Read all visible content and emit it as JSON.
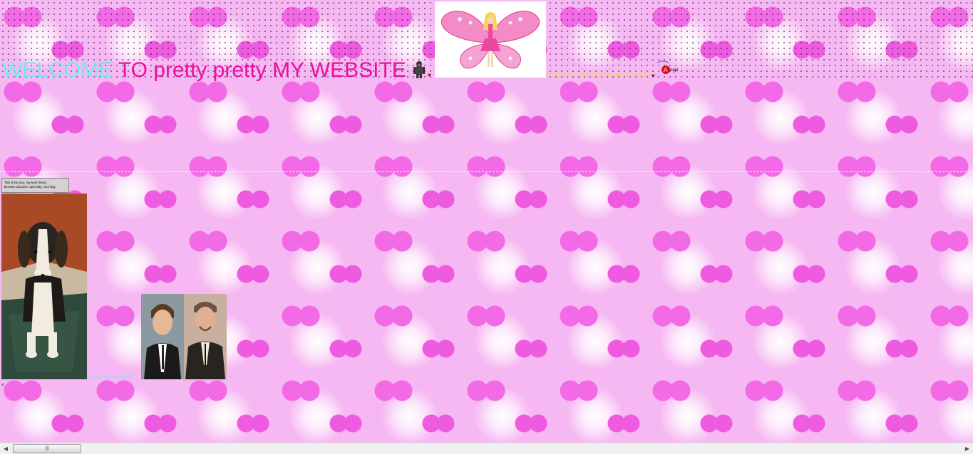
{
  "header": {
    "title_part1": "WELCOME",
    "title_part2": "TO pretty pretty MY WEBSITE",
    "marquee_text": "blinkblinkgirlsgirlsgirlsgirlsgirlsgirlsgirlsgirlsgirlsgirls",
    "heart_glyph": "♥",
    "angel_logo_text": "Angel"
  },
  "note_box": {
    "line1": "This is for you, my best friend.",
    "line2": "Browse pictures: cute kitty, cool dog"
  },
  "gallery": {
    "link_text": "pretty pretty pretty pretty"
  },
  "misc": {
    "small_mark": "<"
  },
  "scrollbar": {
    "left_arrow": "◀",
    "right_arrow": "▶",
    "grip": "|||"
  },
  "colors": {
    "welcome": "#6fe9f4",
    "title": "#e8119e",
    "background": "#f6b8f2",
    "marquee": "#f2e20a"
  }
}
